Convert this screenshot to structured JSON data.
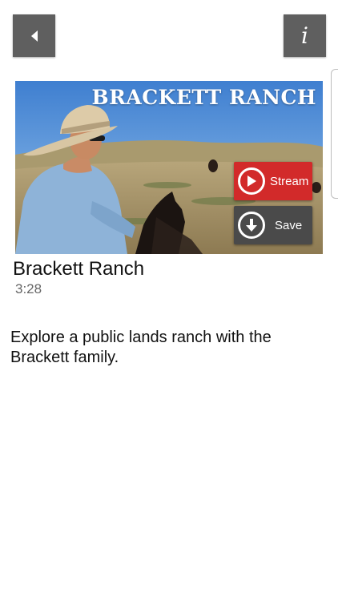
{
  "nav": {
    "back_icon": "back-arrow-icon",
    "info_label": "i"
  },
  "video": {
    "overlay_title": "BRACKETT RANCH",
    "title": "Brackett Ranch",
    "duration": "3:28",
    "description": "Explore a public lands ranch with the Brackett family."
  },
  "actions": {
    "stream_label": "Stream",
    "stream_icon": "play-circle-icon",
    "save_label": "Save",
    "save_icon": "download-circle-icon"
  },
  "colors": {
    "nav_button": "#5f5f5f",
    "stream_button": "#d22a2a",
    "save_button": "#4a4a4a"
  }
}
